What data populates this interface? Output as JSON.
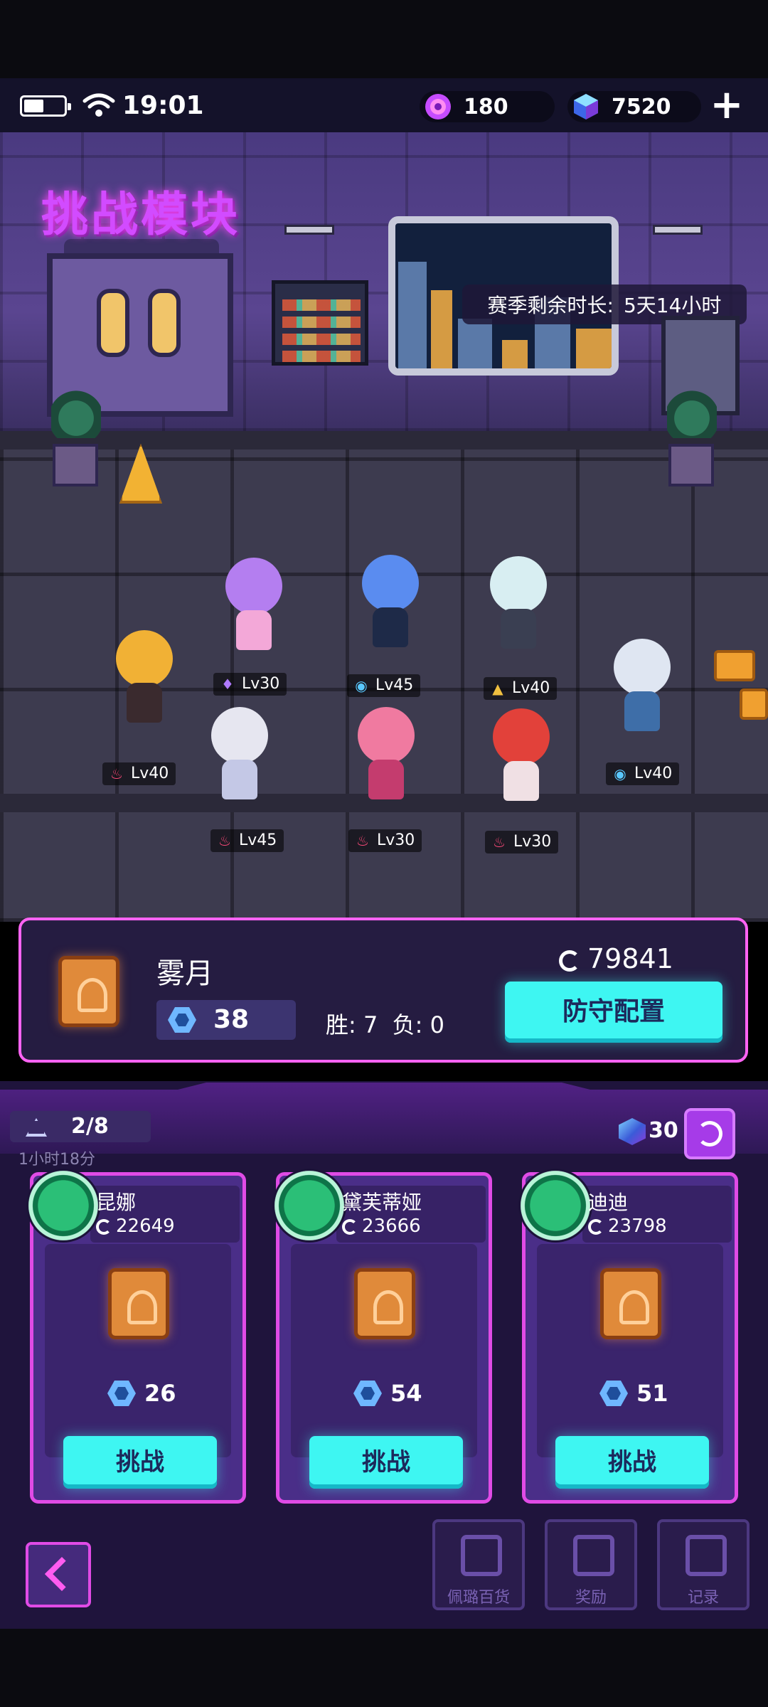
{
  "status_bar": {
    "time": "19:01",
    "battery_level": 0.5,
    "gems": "180",
    "crystals": "7520",
    "add_label": "+"
  },
  "scene": {
    "banner": "挑战模块",
    "season_label": "赛季剩余时长:",
    "season_value": "5天14小时"
  },
  "team": [
    {
      "element": "♦",
      "element_color": "#b07aff",
      "level": "Lv30"
    },
    {
      "element": "◉",
      "element_color": "#5ac8ff",
      "level": "Lv45"
    },
    {
      "element": "▲",
      "element_color": "#f0c040",
      "level": "Lv40"
    },
    {
      "element": "♨",
      "element_color": "#ff4a7a",
      "level": "Lv40"
    },
    {
      "element": "◉",
      "element_color": "#5ac8ff",
      "level": "Lv40"
    },
    {
      "element": "♨",
      "element_color": "#ff4a7a",
      "level": "Lv45"
    },
    {
      "element": "♨",
      "element_color": "#ff4a7a",
      "level": "Lv30"
    },
    {
      "element": "♨",
      "element_color": "#ff4a7a",
      "level": "Lv30"
    }
  ],
  "player": {
    "name": "雾月",
    "rank": "38",
    "win_label": "胜:",
    "wins": "7",
    "loss_label": "负:",
    "losses": "0",
    "power": "79841",
    "defense_button": "防守配置"
  },
  "challenge": {
    "attempts": "2/8",
    "timer": "1小时18分",
    "refresh_cost": "30"
  },
  "opponents": [
    {
      "name": "昆娜",
      "power": "22649",
      "rank": "26",
      "button": "挑战"
    },
    {
      "name": "黛芙蒂娅",
      "power": "23666",
      "rank": "54",
      "button": "挑战"
    },
    {
      "name": "迪迪",
      "power": "23798",
      "rank": "51",
      "button": "挑战"
    }
  ],
  "nav": {
    "shop_label": "佩璐百货",
    "reward_label": "奖励",
    "record_label": "记录"
  },
  "colors": {
    "accent_pink": "#ff63f4",
    "accent_cyan": "#3ef6f2",
    "panel_purple": "#4a2e88"
  }
}
